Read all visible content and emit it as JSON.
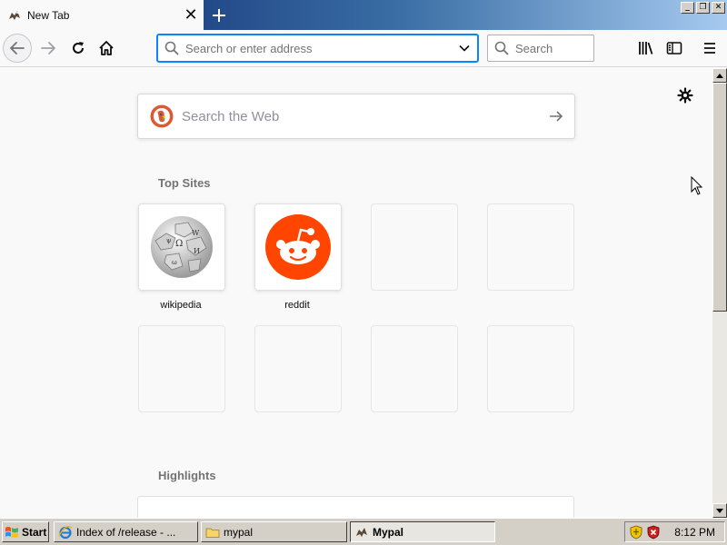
{
  "window": {
    "tab_title": "New Tab",
    "new_tab_symbol": "+",
    "close_tab_symbol": "✕",
    "controls": {
      "minimize": "_",
      "restore": "❐",
      "close": "✕"
    }
  },
  "navbar": {
    "url_placeholder": "Search or enter address",
    "search_placeholder": "Search"
  },
  "newtab": {
    "web_search_placeholder": "Search the Web",
    "top_sites_title": "Top Sites",
    "top_sites": [
      {
        "label": "wikipedia",
        "icon": "wikipedia-globe-icon"
      },
      {
        "label": "reddit",
        "icon": "reddit-alien-icon"
      }
    ],
    "highlights_title": "Highlights"
  },
  "colors": {
    "accent": "#0a84ff",
    "reddit": "#ff4500",
    "duckduckgo": "#de5833"
  },
  "taskbar": {
    "start_label": "Start",
    "tasks": [
      {
        "label": "Index of /release - ...",
        "icon": "ie-icon"
      },
      {
        "label": "mypal",
        "icon": "folder-icon"
      },
      {
        "label": "Mypal",
        "icon": "mypal-icon"
      }
    ],
    "clock": "8:12 PM"
  }
}
